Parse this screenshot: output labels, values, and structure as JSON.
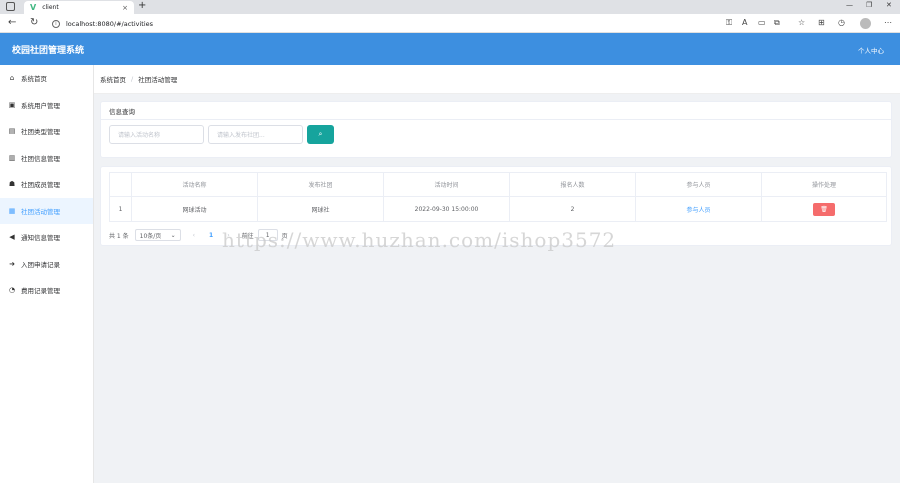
{
  "browser": {
    "tab_title": "client",
    "tab_close": "×",
    "new_tab": "+",
    "url": "localhost:8080/#/activities",
    "minimize": "—",
    "restore": "❐",
    "close": "✕"
  },
  "header": {
    "app_title": "校园社团管理系统",
    "user_center": "个人中心"
  },
  "sidebar": {
    "items": [
      {
        "label": "系统首页",
        "icon": "home-icon"
      },
      {
        "label": "系统用户管理",
        "icon": "user-icon"
      },
      {
        "label": "社团类型管理",
        "icon": "doc-icon"
      },
      {
        "label": "社团信息管理",
        "icon": "info-icon"
      },
      {
        "label": "社团成员管理",
        "icon": "users-icon"
      },
      {
        "label": "社团活动管理",
        "icon": "calendar-icon"
      },
      {
        "label": "通知信息管理",
        "icon": "bullhorn-icon"
      },
      {
        "label": "入团申请记录",
        "icon": "signin-icon"
      },
      {
        "label": "费用记录管理",
        "icon": "clock-icon"
      }
    ],
    "active_index": 5
  },
  "breadcrumb": {
    "home": "系统首页",
    "separator": "/",
    "current": "社团活动管理"
  },
  "query": {
    "title": "信息查询",
    "activity_name_placeholder": "请输入活动名称",
    "club_placeholder": "请输入发布社团...",
    "search_icon": "⌕"
  },
  "table": {
    "columns": [
      "",
      "活动名称",
      "发布社团",
      "活动时间",
      "报名人数",
      "参与人员",
      "操作处理"
    ],
    "rows": [
      {
        "index": "1",
        "name": "网球活动",
        "club": "网球社",
        "time": "2022-09-30 15:00:00",
        "count": "2",
        "participants_link": "参与人员",
        "delete_icon": "🗑"
      }
    ]
  },
  "pager": {
    "total": "共 1 条",
    "page_size": "10条/页",
    "prev": "‹",
    "current_page": "1",
    "next": "›",
    "goto_label": "前往",
    "goto_value": "1",
    "page_suffix": "页"
  },
  "watermark": "https://www.huzhan.com/ishop3572"
}
